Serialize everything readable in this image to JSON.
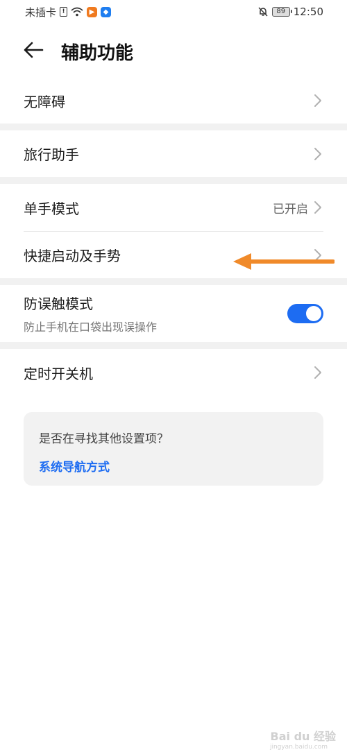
{
  "status_bar": {
    "carrier": "未插卡",
    "battery": "89",
    "time": "12:50",
    "icons": [
      "sim-icon",
      "wifi-icon",
      "orange-app-icon",
      "blue-app-icon",
      "mute-bell-icon",
      "battery-icon"
    ]
  },
  "header": {
    "title": "辅助功能",
    "back_icon": "arrow-left-icon"
  },
  "items": {
    "accessibility": {
      "label": "无障碍"
    },
    "travel_assistant": {
      "label": "旅行助手"
    },
    "one_hand_mode": {
      "label": "单手模式",
      "value": "已开启"
    },
    "shortcuts_gestures": {
      "label": "快捷启动及手势"
    },
    "pocket_mode": {
      "label": "防误触模式",
      "sub": "防止手机在口袋出现误操作",
      "enabled": true
    },
    "scheduled_power": {
      "label": "定时开关机"
    }
  },
  "suggestion": {
    "question": "是否在寻找其他设置项？",
    "link": "系统导航方式"
  },
  "annotation": {
    "arrow_color": "#f08a2a"
  },
  "watermark": {
    "text": "Bai du 经验",
    "sub": "jingyan.baidu.com"
  },
  "colors": {
    "accent": "#1d6cf2",
    "section_gap": "#f1f1f1",
    "card_bg": "#f2f2f2"
  }
}
